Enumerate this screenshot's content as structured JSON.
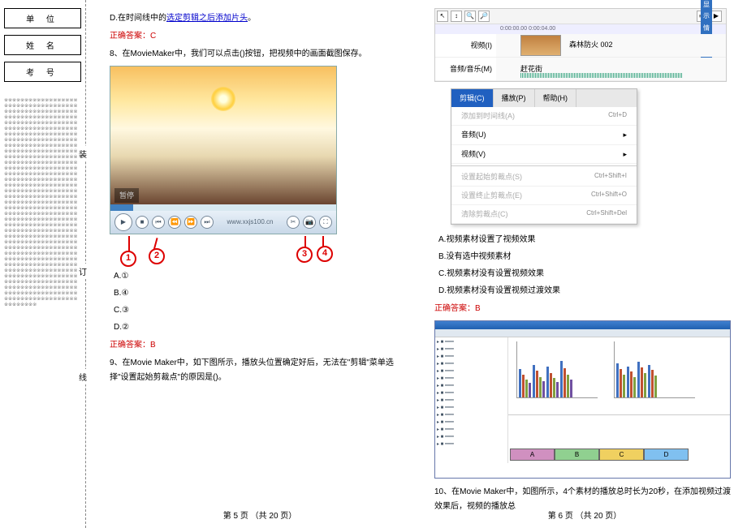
{
  "binding": {
    "unit": "单 位",
    "name": "姓 名",
    "exam_no": "考 号",
    "seal": "装",
    "bind": "订",
    "line": "线"
  },
  "left_page": {
    "q7_option_d_prefix": "D.在时间线中的",
    "q7_option_d_link": "选定剪辑之后添加片头",
    "q7_option_d_suffix": "。",
    "q7_answer": "正确答案：C",
    "q8_text": "8、在MovieMaker中，我们可以点击()按钮，把视频中的画面截图保存。",
    "video_caption": "暂停",
    "video_url": "www.xxjs100.cn",
    "circles": {
      "c1": "1",
      "c2": "2",
      "c3": "3",
      "c4": "4"
    },
    "opt_a": "A.①",
    "opt_b": "B.④",
    "opt_c": "C.③",
    "opt_d": "D.②",
    "q8_answer": "正确答案：B",
    "q9_text": "9、在Movie Maker中，如下图所示，播放头位置确定好后，无法在\"剪辑\"菜单选择\"设置起始剪裁点\"的原因是()。",
    "footer": "第 5 页 （共 20 页）"
  },
  "right_page": {
    "timeline": {
      "marker_label": "显示情节摘要",
      "ruler": "0:00:00.00        0:00:04.00",
      "video_row": "视频(I)",
      "clip_title": "森林防火 002",
      "audio_row": "音频/音乐(M)",
      "audio_clip": "赶花街"
    },
    "menu": {
      "tab_clip": "剪辑(C)",
      "tab_play": "播放(P)",
      "tab_help": "帮助(H)",
      "add_timeline": "添加到时间线(A)",
      "add_timeline_key": "Ctrl+D",
      "audio": "音频(U)",
      "video": "视频(V)",
      "set_start": "设置起始剪裁点(S)",
      "set_start_key": "Ctrl+Shift+I",
      "set_end": "设置终止剪裁点(E)",
      "set_end_key": "Ctrl+Shift+O",
      "clear_trim": "清除剪裁点(C)",
      "clear_trim_key": "Ctrl+Shift+Del"
    },
    "opt_a": "A.视频素材设置了视频效果",
    "opt_b": "B.没有选中视频素材",
    "opt_c": "C.视频素材没有设置视频效果",
    "opt_d": "D.视频素材没有设置视频过渡效果",
    "q9_answer": "正确答案：B",
    "segments": {
      "a": "A",
      "b": "B",
      "c": "C",
      "d": "D"
    },
    "q10_text": "10、在Movie Maker中，如图所示，4个素材的播放总时长为20秒，在添加视频过渡效果后，视频的播放总",
    "footer": "第 6 页 （共 20 页）"
  }
}
